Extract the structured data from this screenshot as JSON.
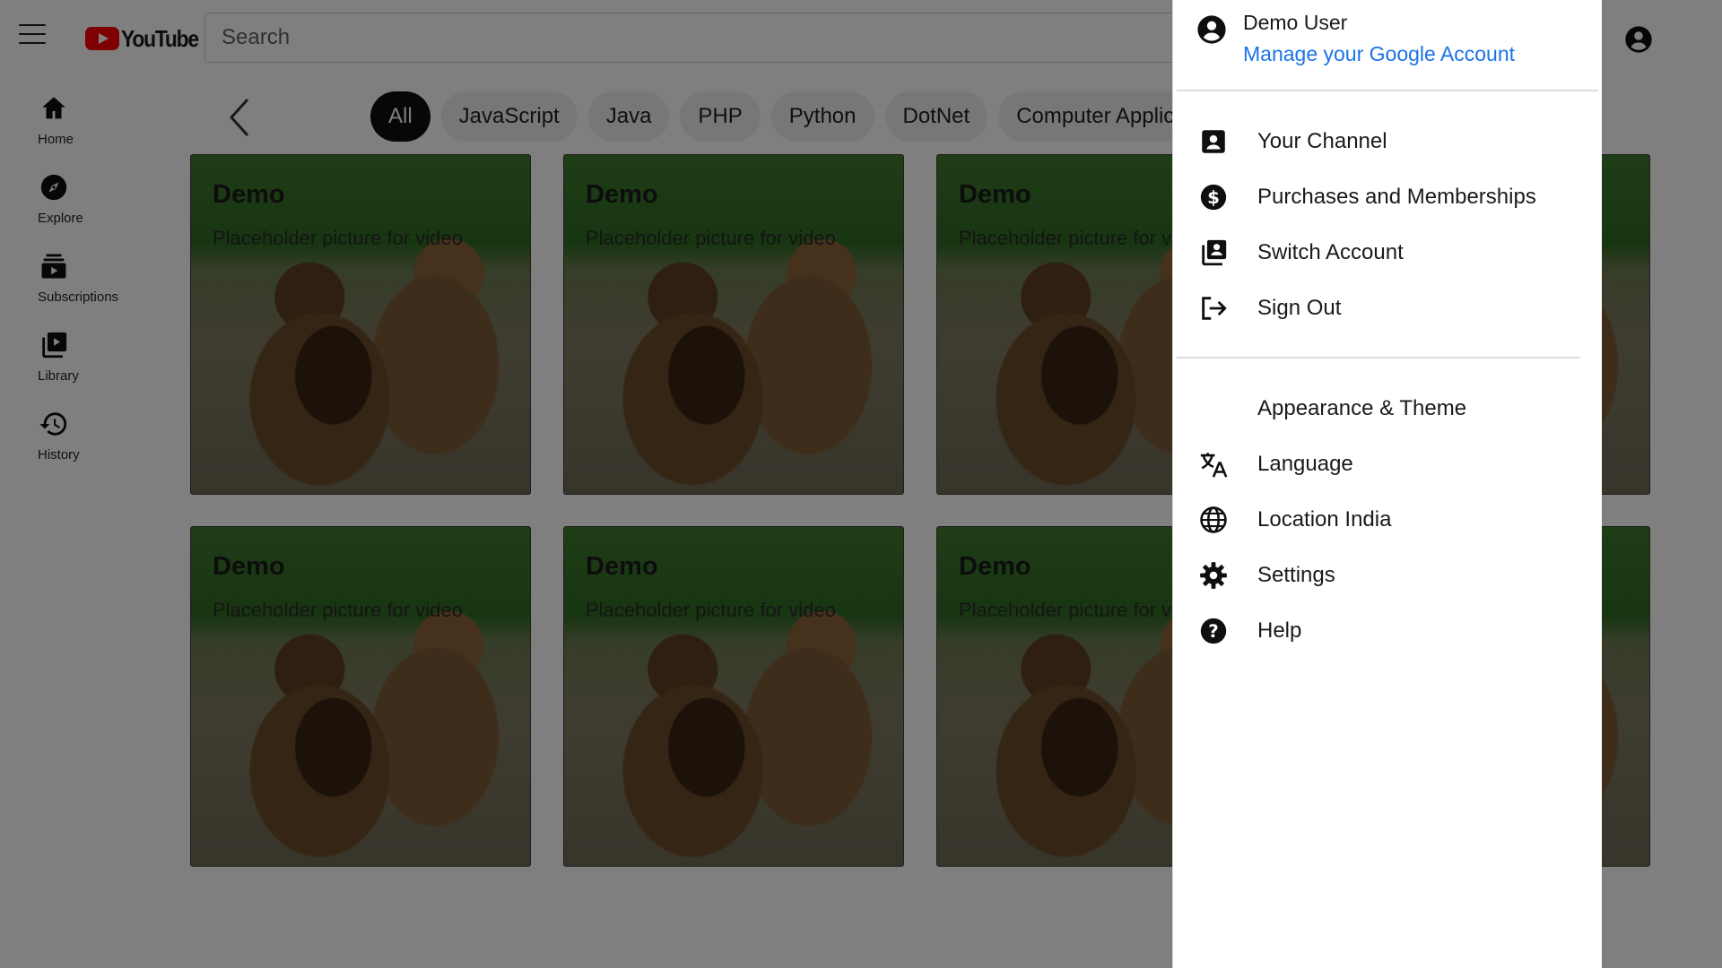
{
  "header": {
    "logo_text": "YouTube",
    "search_placeholder": "Search"
  },
  "sidebar": {
    "items": [
      {
        "label": "Home",
        "icon": "home-icon"
      },
      {
        "label": "Explore",
        "icon": "compass-icon"
      },
      {
        "label": "Subscriptions",
        "icon": "subscriptions-icon"
      },
      {
        "label": "Library",
        "icon": "library-icon"
      },
      {
        "label": "History",
        "icon": "history-icon"
      }
    ]
  },
  "chips": [
    "All",
    "JavaScript",
    "Java",
    "PHP",
    "Python",
    "DotNet",
    "Computer Application"
  ],
  "video_card": {
    "title": "Demo",
    "subtitle": "Placeholder picture for video"
  },
  "account_menu": {
    "user_name": "Demo User",
    "manage_link": "Manage your Google Account",
    "section1": [
      {
        "label": "Your Channel",
        "icon": "channel-icon"
      },
      {
        "label": "Purchases and Memberships",
        "icon": "dollar-icon"
      },
      {
        "label": "Switch Account",
        "icon": "switch-account-icon"
      },
      {
        "label": "Sign Out",
        "icon": "sign-out-icon"
      }
    ],
    "section2": [
      {
        "label": "Appearance & Theme",
        "icon": "moon-icon"
      },
      {
        "label": "Language",
        "icon": "translate-icon"
      },
      {
        "label": "Location India",
        "icon": "globe-icon"
      },
      {
        "label": "Settings",
        "icon": "gear-icon"
      },
      {
        "label": "Help",
        "icon": "help-icon"
      }
    ]
  },
  "colors": {
    "brand_red": "#ff0000",
    "link_blue": "#1a73e8",
    "chip_active_bg": "#0f0f0f",
    "overlay": "rgba(0,0,0,0.5)"
  }
}
